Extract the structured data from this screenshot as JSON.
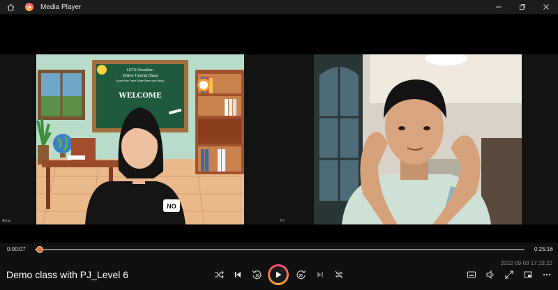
{
  "window": {
    "title": "Media Player",
    "icons": {
      "home": "home-icon",
      "app": "media-player-icon",
      "minimize": "minimize-icon",
      "restore": "restore-icon",
      "close": "close-icon"
    }
  },
  "video": {
    "left_participant": {
      "name": "Anna",
      "board_line1": "LETS DreaSion",
      "board_line2": "Online Tutorial Class",
      "board_line3": "(Learn Earn Teach Share Dream and Vision)",
      "board_welcome": "WELCOME",
      "shirt_text": "NO"
    },
    "right_participant": {
      "name": "PJ"
    }
  },
  "player": {
    "elapsed": "0:00:07",
    "total": "0:25:16",
    "progress_fraction": 0.005,
    "media_title": "Demo class with PJ_Level 6",
    "timestamp": "2022-09-03 17:13:22",
    "skip_back_seconds": "10",
    "skip_forward_seconds": "30",
    "accent_color": "#ff7a3d",
    "controls": [
      "shuffle-icon",
      "previous-icon",
      "skip-back-10-icon",
      "play-icon",
      "skip-forward-30-icon",
      "next-icon",
      "repeat-icon",
      "aspect-ratio-icon",
      "volume-icon",
      "fullscreen-icon",
      "miniplayer-icon",
      "more-icon"
    ]
  }
}
